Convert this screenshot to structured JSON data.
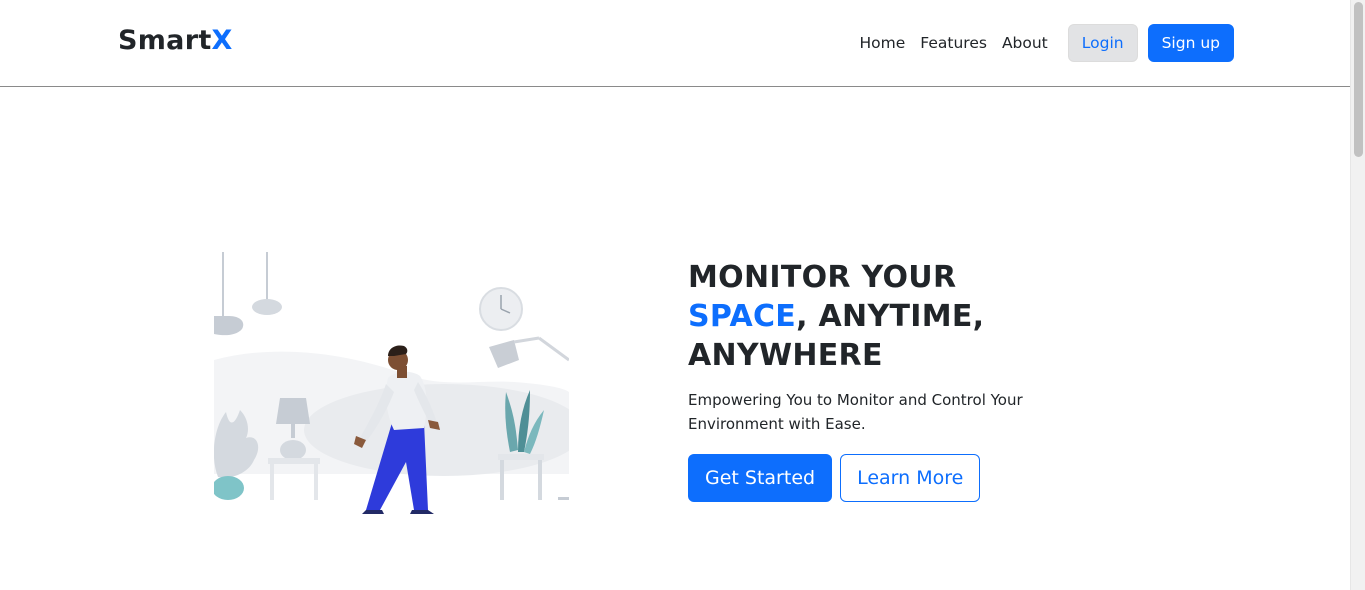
{
  "brand": {
    "name_prefix": "Smart",
    "name_accent": "X"
  },
  "nav": {
    "links": [
      "Home",
      "Features",
      "About"
    ],
    "login_label": "Login",
    "signup_label": "Sign up"
  },
  "hero": {
    "title_line1": "MONITOR YOUR",
    "title_accent": "SPACE",
    "title_line2_rest": ", ANYTIME,",
    "title_line3": "ANYWHERE",
    "subtitle": "Empowering You to Monitor and Control Your Environment with Ease.",
    "primary_label": "Get Started",
    "secondary_label": "Learn More",
    "illustration_icon": "person-walking-room-illustration"
  },
  "colors": {
    "accent": "#0d6efd",
    "text": "#212529",
    "login_bg": "#e2e3e5"
  }
}
